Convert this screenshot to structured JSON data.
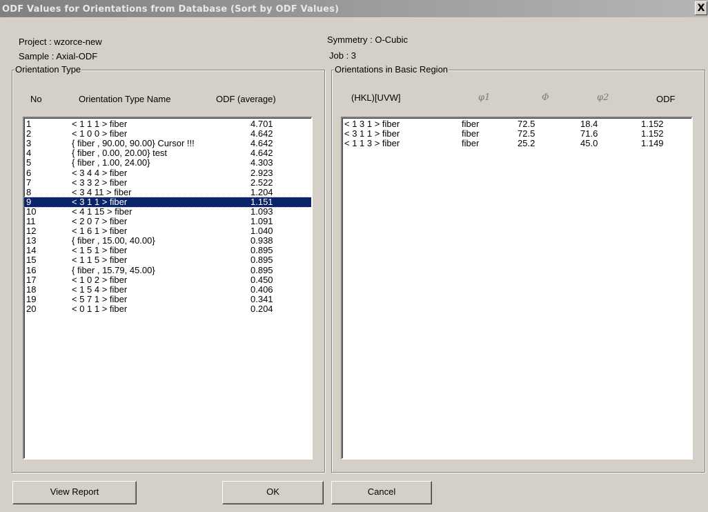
{
  "window": {
    "title": "ODF Values for Orientations from Database (Sort by ODF Values)",
    "close_label": "X"
  },
  "info": {
    "project": "Project :  wzorce-new",
    "sample": "Sample :  Axial-ODF",
    "symmetry": "Symmetry :  O-Cubic",
    "job": "Job :  3"
  },
  "left_panel": {
    "legend": "Orientation Type",
    "headers": {
      "no": "No",
      "name": "Orientation Type Name",
      "odf": "ODF (average)"
    },
    "rows": [
      {
        "no": "1",
        "name": "< 1  1  1 > fiber",
        "odf": "4.701"
      },
      {
        "no": "2",
        "name": "< 1  0  0 > fiber",
        "odf": "4.642"
      },
      {
        "no": "3",
        "name": "{ fiber  ,  90.00,  90.00}  Cursor !!!",
        "odf": "4.642"
      },
      {
        "no": "4",
        "name": "{ fiber  ,   0.00,  20.00} test",
        "odf": "4.642"
      },
      {
        "no": "5",
        "name": "{ fiber  ,   1.00,  24.00}",
        "odf": "4.303"
      },
      {
        "no": "6",
        "name": "< 3  4  4 > fiber",
        "odf": "2.923"
      },
      {
        "no": "7",
        "name": "< 3  3  2 > fiber",
        "odf": "2.522"
      },
      {
        "no": "8",
        "name": "< 3  4 11 > fiber",
        "odf": "1.204"
      },
      {
        "no": "9",
        "name": "< 3  1  1 > fiber",
        "odf": "1.151"
      },
      {
        "no": "10",
        "name": "< 4  1 15 > fiber",
        "odf": "1.093"
      },
      {
        "no": "11",
        "name": "< 2  0  7 > fiber",
        "odf": "1.091"
      },
      {
        "no": "12",
        "name": "< 1  6  1 > fiber",
        "odf": "1.040"
      },
      {
        "no": "13",
        "name": "{ fiber  ,  15.00,  40.00}",
        "odf": "0.938"
      },
      {
        "no": "14",
        "name": "< 1  5  1 > fiber",
        "odf": "0.895"
      },
      {
        "no": "15",
        "name": "< 1  1  5 > fiber",
        "odf": "0.895"
      },
      {
        "no": "16",
        "name": "{ fiber  ,  15.79,  45.00}",
        "odf": "0.895"
      },
      {
        "no": "17",
        "name": "< 1  0  2 > fiber",
        "odf": "0.450"
      },
      {
        "no": "18",
        "name": "< 1  5  4 > fiber",
        "odf": "0.406"
      },
      {
        "no": "19",
        "name": "< 5  7  1 > fiber",
        "odf": "0.341"
      },
      {
        "no": "20",
        "name": "< 0  1  1 > fiber",
        "odf": "0.204"
      }
    ],
    "selected_row": "9"
  },
  "right_panel": {
    "legend": "Orientations in Basic Region",
    "headers": {
      "hkl": "(HKL)[UVW]",
      "phi1": "φ1",
      "phi": "Φ",
      "phi2": "φ2",
      "odf": "ODF"
    },
    "rows": [
      {
        "hkl": "< 1  3  1 > fiber",
        "phi1": "fiber",
        "phi": "72.5",
        "phi2": "18.4",
        "odf": "1.152"
      },
      {
        "hkl": "< 3  1  1 > fiber",
        "phi1": "fiber",
        "phi": "72.5",
        "phi2": "71.6",
        "odf": "1.152"
      },
      {
        "hkl": "< 1  1  3 > fiber",
        "phi1": "fiber",
        "phi": "25.2",
        "phi2": "45.0",
        "odf": "1.149"
      }
    ]
  },
  "buttons": {
    "view_report": "View Report",
    "ok": "OK",
    "cancel": "Cancel"
  },
  "colors": {
    "dialog_bg": "#d4d0c8",
    "selection": "#0a246a",
    "titlebar": "#808080"
  }
}
